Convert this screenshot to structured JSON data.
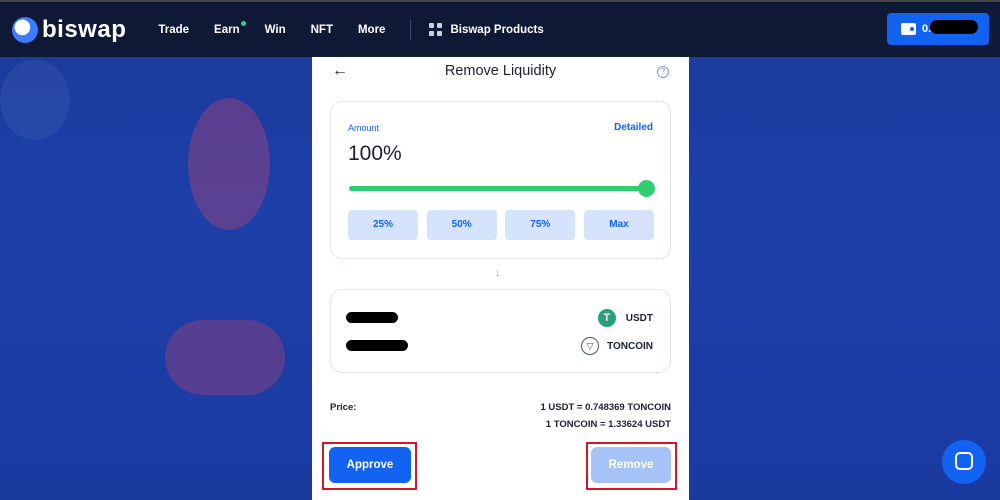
{
  "brand": {
    "name": "biswap",
    "accent": "#1263f1"
  },
  "nav": {
    "items": [
      {
        "label": "Trade"
      },
      {
        "label": "Earn",
        "has_dot": true
      },
      {
        "label": "Win"
      },
      {
        "label": "NFT"
      },
      {
        "label": "More"
      }
    ],
    "products_label": "Biswap Products"
  },
  "wallet": {
    "balance_prefix": "0."
  },
  "panel": {
    "title": "Remove Liquidity",
    "amount": {
      "label": "Amount",
      "detailed_label": "Detailed",
      "value_text": "100%",
      "slider_fraction": 1.0,
      "presets": [
        "25%",
        "50%",
        "75%",
        "Max"
      ]
    },
    "tokens": [
      {
        "symbol": "USDT",
        "icon": "tether-icon"
      },
      {
        "symbol": "TONCOIN",
        "icon": "toncoin-icon"
      }
    ],
    "price": {
      "label": "Price:",
      "rate1": "1 USDT = 0.748369 TONCOIN",
      "rate2": "1 TONCOIN = 1.33624 USDT"
    },
    "buttons": {
      "approve": "Approve",
      "remove": "Remove"
    }
  }
}
